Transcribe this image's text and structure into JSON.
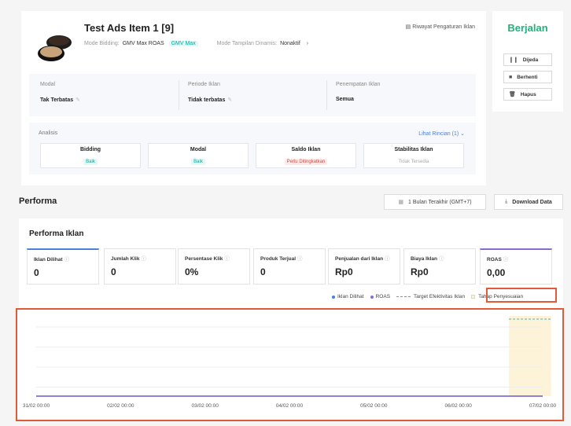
{
  "ad": {
    "title": "Test Ads Item 1 [9]",
    "bidding_label": "Mode Bidding:",
    "bidding_value": "GMV Max ROAS",
    "bidding_tag": "GMV Max",
    "dynamic_label": "Mode Tampilan Dinamis:",
    "dynamic_value": "Nonaktif",
    "history_link": "Riwayat Pengaturan Iklan"
  },
  "info": [
    {
      "label": "Modal",
      "value": "Tak Terbatas"
    },
    {
      "label": "Periode Iklan",
      "value": "Tidak terbatas"
    },
    {
      "label": "Penempatan Iklan",
      "value": "Semua"
    }
  ],
  "analysis": {
    "label": "Analisis",
    "detail_link": "Lihat Rincian (1)",
    "metrics": [
      {
        "title": "Bidding",
        "status": "Baik",
        "kind": "good"
      },
      {
        "title": "Modal",
        "status": "Baik",
        "kind": "good"
      },
      {
        "title": "Saldo Iklan",
        "status": "Perlu Ditingkatkan",
        "kind": "warn"
      },
      {
        "title": "Stabilitas Iklan",
        "status": "Tidak Tersedia",
        "kind": "na"
      }
    ]
  },
  "status": {
    "title": "Berjalan",
    "buttons": [
      "Dijeda",
      "Berhenti",
      "Hapus"
    ]
  },
  "performa": {
    "title": "Performa",
    "date_range": "1 Bulan Terakhir (GMT+7)",
    "download": "Download Data",
    "subtitle": "Performa Iklan",
    "kpis": [
      {
        "label": "Iklan Dilihat",
        "value": "0"
      },
      {
        "label": "Jumlah Klik",
        "value": "0"
      },
      {
        "label": "Persentase Klik",
        "value": "0%"
      },
      {
        "label": "Produk Terjual",
        "value": "0"
      },
      {
        "label": "Penjualan dari Iklan",
        "value": "Rp0"
      },
      {
        "label": "Biaya Iklan",
        "value": "Rp0"
      },
      {
        "label": "ROAS",
        "value": "0,00"
      }
    ],
    "legend": {
      "seen": "Iklan Dilihat",
      "roas": "ROAS",
      "target": "Target Efektivitas Iklan",
      "adjust": "Tahap Penyesuaian"
    }
  },
  "chart_data": {
    "type": "line",
    "x": [
      "31/02 00:00",
      "02/02 00:00",
      "03/02 00:00",
      "04/02 00:00",
      "05/02 00:00",
      "06/02 00:00",
      "07/02 00:00"
    ],
    "series": [
      {
        "name": "Iklan Dilihat",
        "values": [
          0,
          0,
          0,
          0,
          0,
          0,
          0
        ]
      },
      {
        "name": "ROAS",
        "values": [
          0,
          0,
          0,
          0,
          0,
          0,
          0
        ]
      }
    ],
    "grid": true,
    "legend_position": "top-right",
    "colors": {
      "seen": "#4a7fe0",
      "roas": "#8a6bd1",
      "target": "#4fb3a8",
      "adjust": "#fdf3d8"
    }
  }
}
